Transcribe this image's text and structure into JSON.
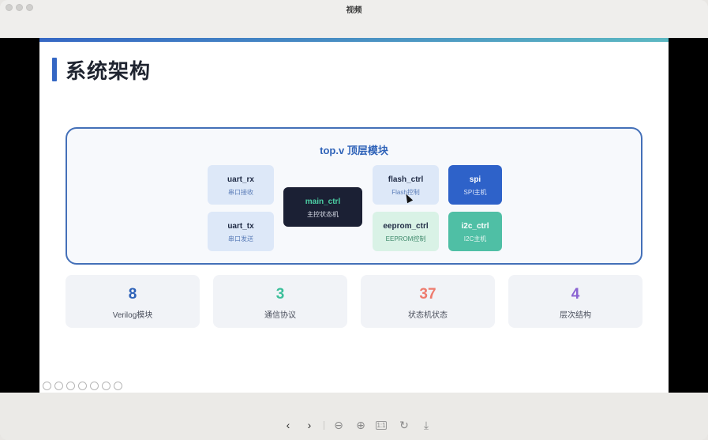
{
  "window": {
    "title": "视频"
  },
  "slide": {
    "heading": "系统架构",
    "diagram": {
      "title": "top.v 顶层模块",
      "modules": [
        {
          "name": "uart_rx",
          "desc": "串口接收"
        },
        {
          "name": "uart_tx",
          "desc": "串口发送"
        },
        {
          "name": "main_ctrl",
          "desc": "主控状态机"
        },
        {
          "name": "flash_ctrl",
          "desc": "Flash控制"
        },
        {
          "name": "eeprom_ctrl",
          "desc": "EEPROM控制"
        },
        {
          "name": "spi",
          "desc": "SPI主机"
        },
        {
          "name": "i2c_ctrl",
          "desc": "I2C主机"
        }
      ]
    },
    "stats": [
      {
        "value": "8",
        "label": "Verilog模块",
        "color": "#2e62b8"
      },
      {
        "value": "3",
        "label": "通信协议",
        "color": "#3bbf9a"
      },
      {
        "value": "37",
        "label": "状态机状态",
        "color": "#ee7b6e"
      },
      {
        "value": "4",
        "label": "层次结构",
        "color": "#8a63d2"
      }
    ]
  },
  "colors": {
    "accent": "#3567c4",
    "diagram_border": "#4470b8"
  },
  "toolbar": {
    "prev_glyph": "‹",
    "next_glyph": "›",
    "zoom_out_glyph": "⊖",
    "zoom_in_glyph": "⊕",
    "actual_size_glyph": "1:1",
    "rotate_glyph": "↻",
    "download_glyph": "⤓"
  }
}
